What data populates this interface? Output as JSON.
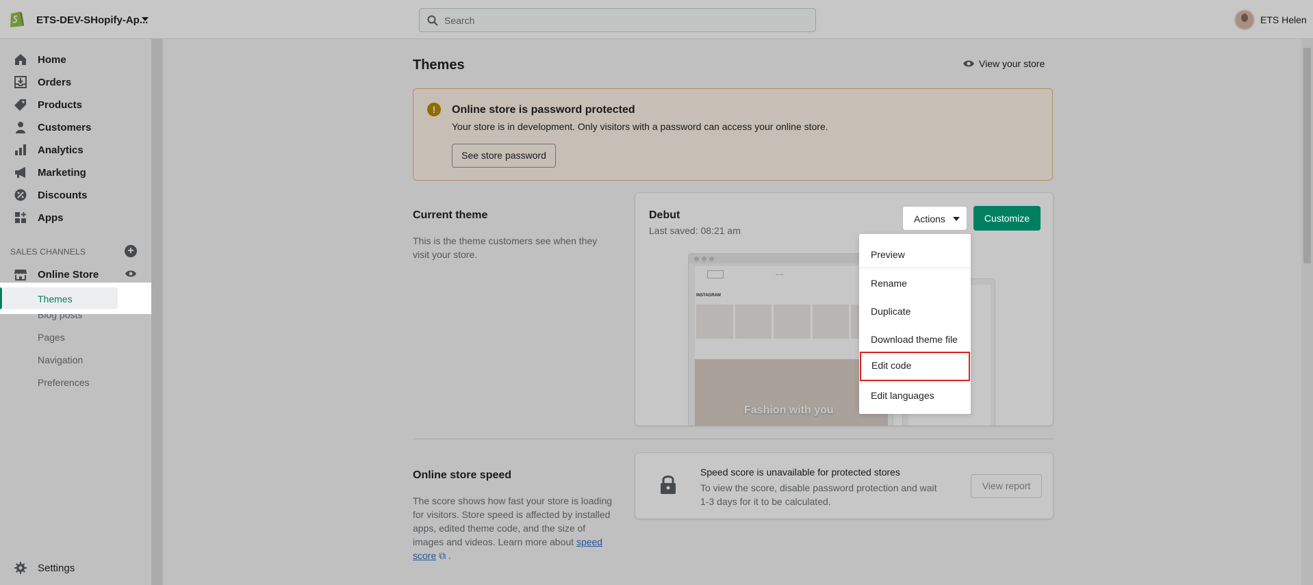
{
  "topbar": {
    "store_name": "ETS-DEV-SHopify-Ap...",
    "search_placeholder": "Search",
    "user_name": "ETS Helen"
  },
  "sidebar": {
    "items": [
      {
        "label": "Home",
        "icon": "home-icon"
      },
      {
        "label": "Orders",
        "icon": "orders-icon"
      },
      {
        "label": "Products",
        "icon": "tag-icon"
      },
      {
        "label": "Customers",
        "icon": "person-icon"
      },
      {
        "label": "Analytics",
        "icon": "bar-chart-icon"
      },
      {
        "label": "Marketing",
        "icon": "megaphone-icon"
      },
      {
        "label": "Discounts",
        "icon": "discount-icon"
      },
      {
        "label": "Apps",
        "icon": "apps-icon"
      }
    ],
    "sales_channels_label": "SALES CHANNELS",
    "online_store_label": "Online Store",
    "sub_items": [
      "Themes",
      "Blog posts",
      "Pages",
      "Navigation",
      "Preferences"
    ],
    "settings_label": "Settings"
  },
  "page": {
    "title": "Themes",
    "view_store": "View your store"
  },
  "banner": {
    "title": "Online store is password protected",
    "text": "Your store is in development. Only visitors with a password can access your online store.",
    "button": "See store password"
  },
  "current_theme": {
    "section_title": "Current theme",
    "section_desc": "This is the theme customers see when they visit your store.",
    "name": "Debut",
    "saved": "Last saved: 08:21 am",
    "actions_label": "Actions",
    "customize_label": "Customize",
    "preview_hero_text": "Fashion with you",
    "preview_insta": "INSTAGRAM"
  },
  "actions_menu": {
    "items": [
      "Preview",
      "Rename",
      "Duplicate",
      "Download theme file",
      "Edit code",
      "Edit languages"
    ],
    "highlighted": "Edit code"
  },
  "speed": {
    "section_title": "Online store speed",
    "section_desc": "The score shows how fast your store is loading for visitors. Store speed is affected by installed apps, edited theme code, and the size of images and videos. Learn more about",
    "link": "speed score",
    "link_suffix": ".",
    "card_title": "Speed score is unavailable for protected stores",
    "card_text": "To view the score, disable password protection and wait 1-3 days for it to be calculated.",
    "button": "View report"
  },
  "colors": {
    "accent": "#008060",
    "highlight_border": "#e02020",
    "banner_bg": "#fff5ea"
  }
}
